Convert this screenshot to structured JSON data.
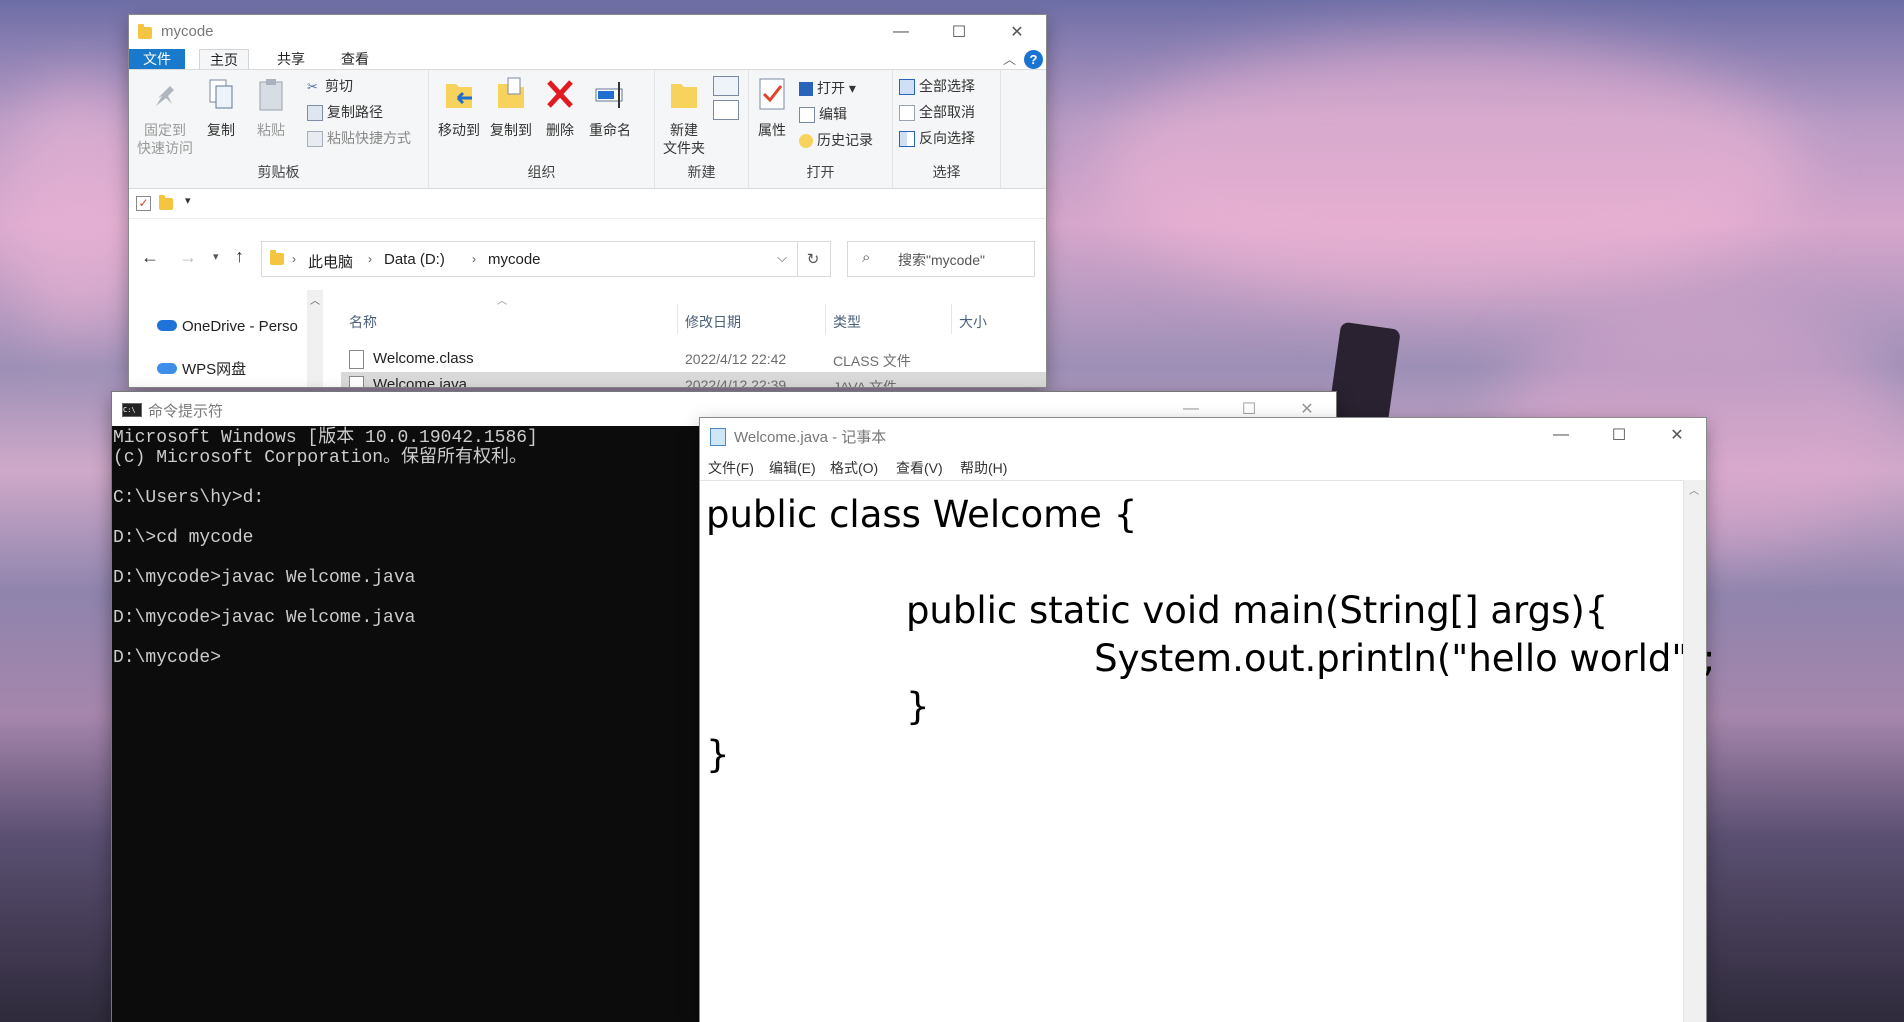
{
  "explorer": {
    "title": "mycode",
    "tabs": [
      "文件",
      "主页",
      "共享",
      "查看"
    ],
    "ribbon": {
      "clipboard": {
        "pin": "固定到\n快速访问",
        "copy": "复制",
        "paste": "粘贴",
        "cut": "剪切",
        "copy_path": "复制路径",
        "paste_shortcut": "粘贴快捷方式",
        "label": "剪贴板"
      },
      "organize": {
        "move_to": "移动到",
        "copy_to": "复制到",
        "delete": "删除",
        "rename": "重命名",
        "label": "组织"
      },
      "new": {
        "new_folder": "新建\n文件夹",
        "label": "新建"
      },
      "open": {
        "properties": "属性",
        "open": "打开",
        "edit": "编辑",
        "history": "历史记录",
        "label": "打开"
      },
      "select": {
        "select_all": "全部选择",
        "select_none": "全部取消",
        "invert": "反向选择",
        "label": "选择"
      }
    },
    "address": {
      "crumbs": [
        "此电脑",
        "Data (D:)",
        "mycode"
      ]
    },
    "search_placeholder": "搜索\"mycode\"",
    "nav": [
      "OneDrive - Perso",
      "WPS网盘"
    ],
    "columns": {
      "name": "名称",
      "date": "修改日期",
      "type": "类型",
      "size": "大小"
    },
    "files": [
      {
        "name": "Welcome.class",
        "date": "2022/4/12 22:42",
        "type": "CLASS 文件"
      },
      {
        "name": "Welcome.java",
        "date": "2022/4/12 22:39",
        "type": "JAVA 文件"
      }
    ]
  },
  "cmd": {
    "title": "命令提示符",
    "lines": "Microsoft Windows [版本 10.0.19042.1586]\n(c) Microsoft Corporation。保留所有权利。\n\nC:\\Users\\hy>d:\n\nD:\\>cd mycode\n\nD:\\mycode>javac Welcome.java\n\nD:\\mycode>javac Welcome.java\n\nD:\\mycode>"
  },
  "notepad": {
    "title": "Welcome.java - 记事本",
    "menu": [
      "文件(F)",
      "编辑(E)",
      "格式(O)",
      "查看(V)",
      "帮助(H)"
    ],
    "content": "public class Welcome {\n\n                 public static void main(String[] args){\n                                 System.out.println(\"hello world\");\n                 }\n}"
  }
}
